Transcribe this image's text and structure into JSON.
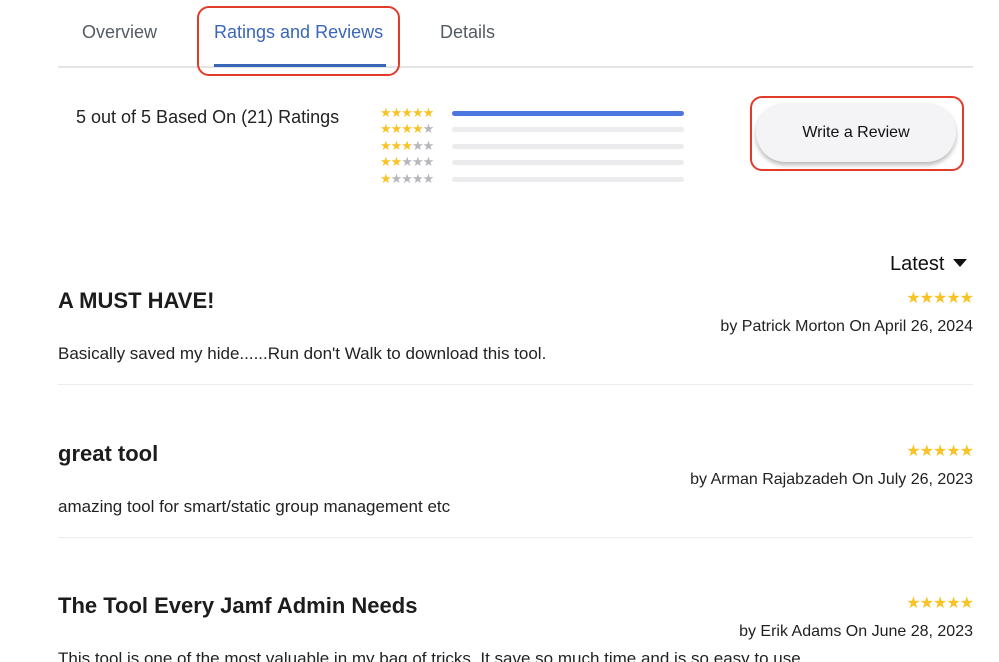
{
  "tabs": [
    {
      "label": "Overview"
    },
    {
      "label": "Ratings and Reviews"
    },
    {
      "label": "Details"
    }
  ],
  "active_tab": "Ratings and Reviews",
  "summary": {
    "text": "5 out of 5 Based On (21) Ratings",
    "average": 5,
    "count": 21
  },
  "distribution": [
    {
      "stars": 5,
      "fraction": 1.0
    },
    {
      "stars": 4,
      "fraction": 0.0
    },
    {
      "stars": 3,
      "fraction": 0.0
    },
    {
      "stars": 2,
      "fraction": 0.0
    },
    {
      "stars": 1,
      "fraction": 0.0
    }
  ],
  "write_review_label": "Write a Review",
  "sort": {
    "label": "Latest"
  },
  "reviews": [
    {
      "title": "A MUST HAVE!",
      "rating": 5,
      "byline": "by Patrick Morton On April 26, 2024",
      "body": "Basically saved my hide......Run don't Walk to download this tool."
    },
    {
      "title": "great tool",
      "rating": 5,
      "byline": "by Arman Rajabzadeh On July 26, 2023",
      "body": "amazing tool for smart/static group management etc"
    },
    {
      "title": "The Tool Every Jamf Admin Needs",
      "rating": 5,
      "byline": "by Erik Adams On June 28, 2023",
      "body": "This tool is one of the most valuable in my bag of tricks. It save so much time and is so easy to use."
    }
  ],
  "colors": {
    "accent": "#3a66b8",
    "bar_fill": "#4a78e0",
    "star": "#f7c325",
    "highlight": "#e23b2a"
  }
}
